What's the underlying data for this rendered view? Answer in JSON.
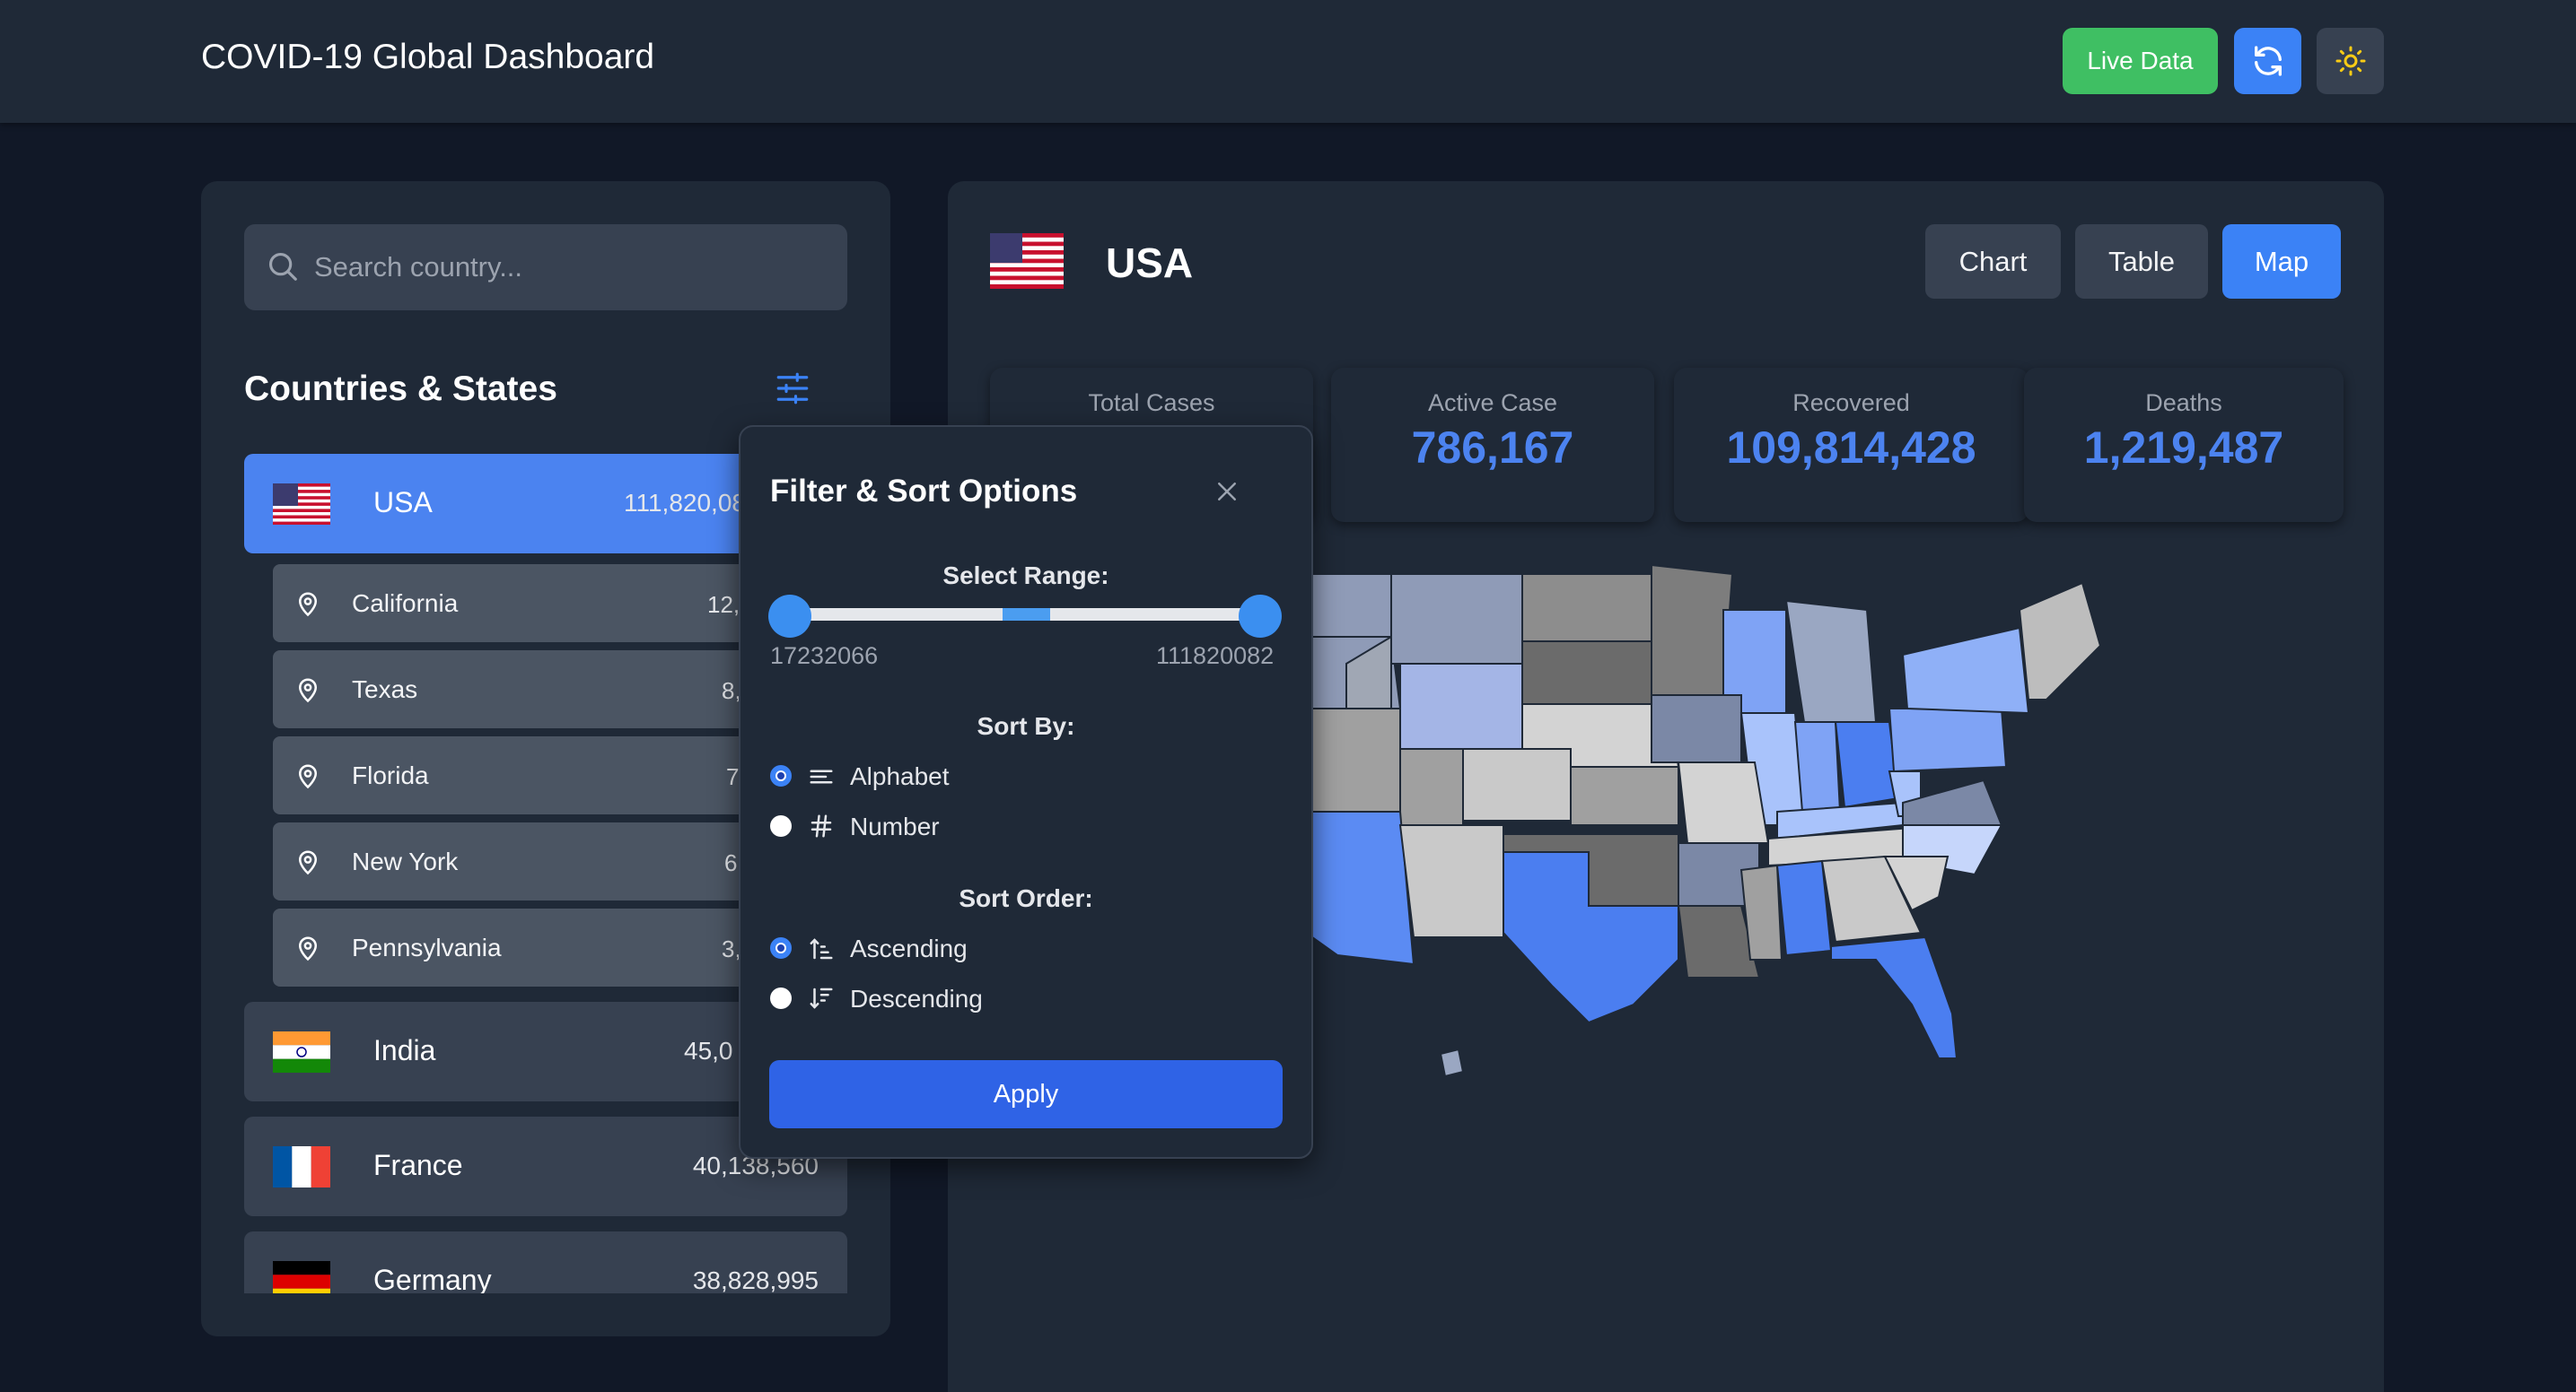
{
  "header": {
    "title": "COVID-19 Global Dashboard",
    "live_label": "Live Data",
    "refresh_icon": "refresh-icon",
    "theme_icon": "sun-icon"
  },
  "sidebar": {
    "search_placeholder": "Search country...",
    "list_title": "Countries & States",
    "countries": [
      {
        "name": "USA",
        "value": "111,820,08",
        "active": true,
        "states": [
          {
            "name": "California",
            "value": "12,"
          },
          {
            "name": "Texas",
            "value": "8,"
          },
          {
            "name": "Florida",
            "value": "7"
          },
          {
            "name": "New York",
            "value": "6"
          },
          {
            "name": "Pennsylvania",
            "value": "3,"
          }
        ]
      },
      {
        "name": "India",
        "value": "45,0"
      },
      {
        "name": "France",
        "value": "40,138,560"
      },
      {
        "name": "Germany",
        "value": "38,828,995"
      }
    ]
  },
  "main": {
    "title": "USA",
    "tabs": [
      {
        "label": "Chart",
        "active": false
      },
      {
        "label": "Table",
        "active": false
      },
      {
        "label": "Map",
        "active": true
      }
    ],
    "stats": [
      {
        "label": "Total Cases",
        "value": ""
      },
      {
        "label": "Active Case",
        "value": "786,167"
      },
      {
        "label": "Recovered",
        "value": "109,814,428"
      },
      {
        "label": "Deaths",
        "value": "1,219,487"
      }
    ],
    "accent_color": "#4c83f0"
  },
  "popup": {
    "title": "Filter & Sort Options",
    "range_label": "Select Range:",
    "range_min": "17232066",
    "range_max": "111820082",
    "sort_by_label": "Sort By:",
    "sort_by_options": [
      {
        "label": "Alphabet",
        "checked": true,
        "icon": "align-left-icon"
      },
      {
        "label": "Number",
        "checked": false,
        "icon": "hash-icon"
      }
    ],
    "sort_order_label": "Sort Order:",
    "sort_order_options": [
      {
        "label": "Ascending",
        "checked": true,
        "icon": "sort-ascending-icon"
      },
      {
        "label": "Descending",
        "checked": false,
        "icon": "sort-descending-icon"
      }
    ],
    "apply_label": "Apply"
  }
}
